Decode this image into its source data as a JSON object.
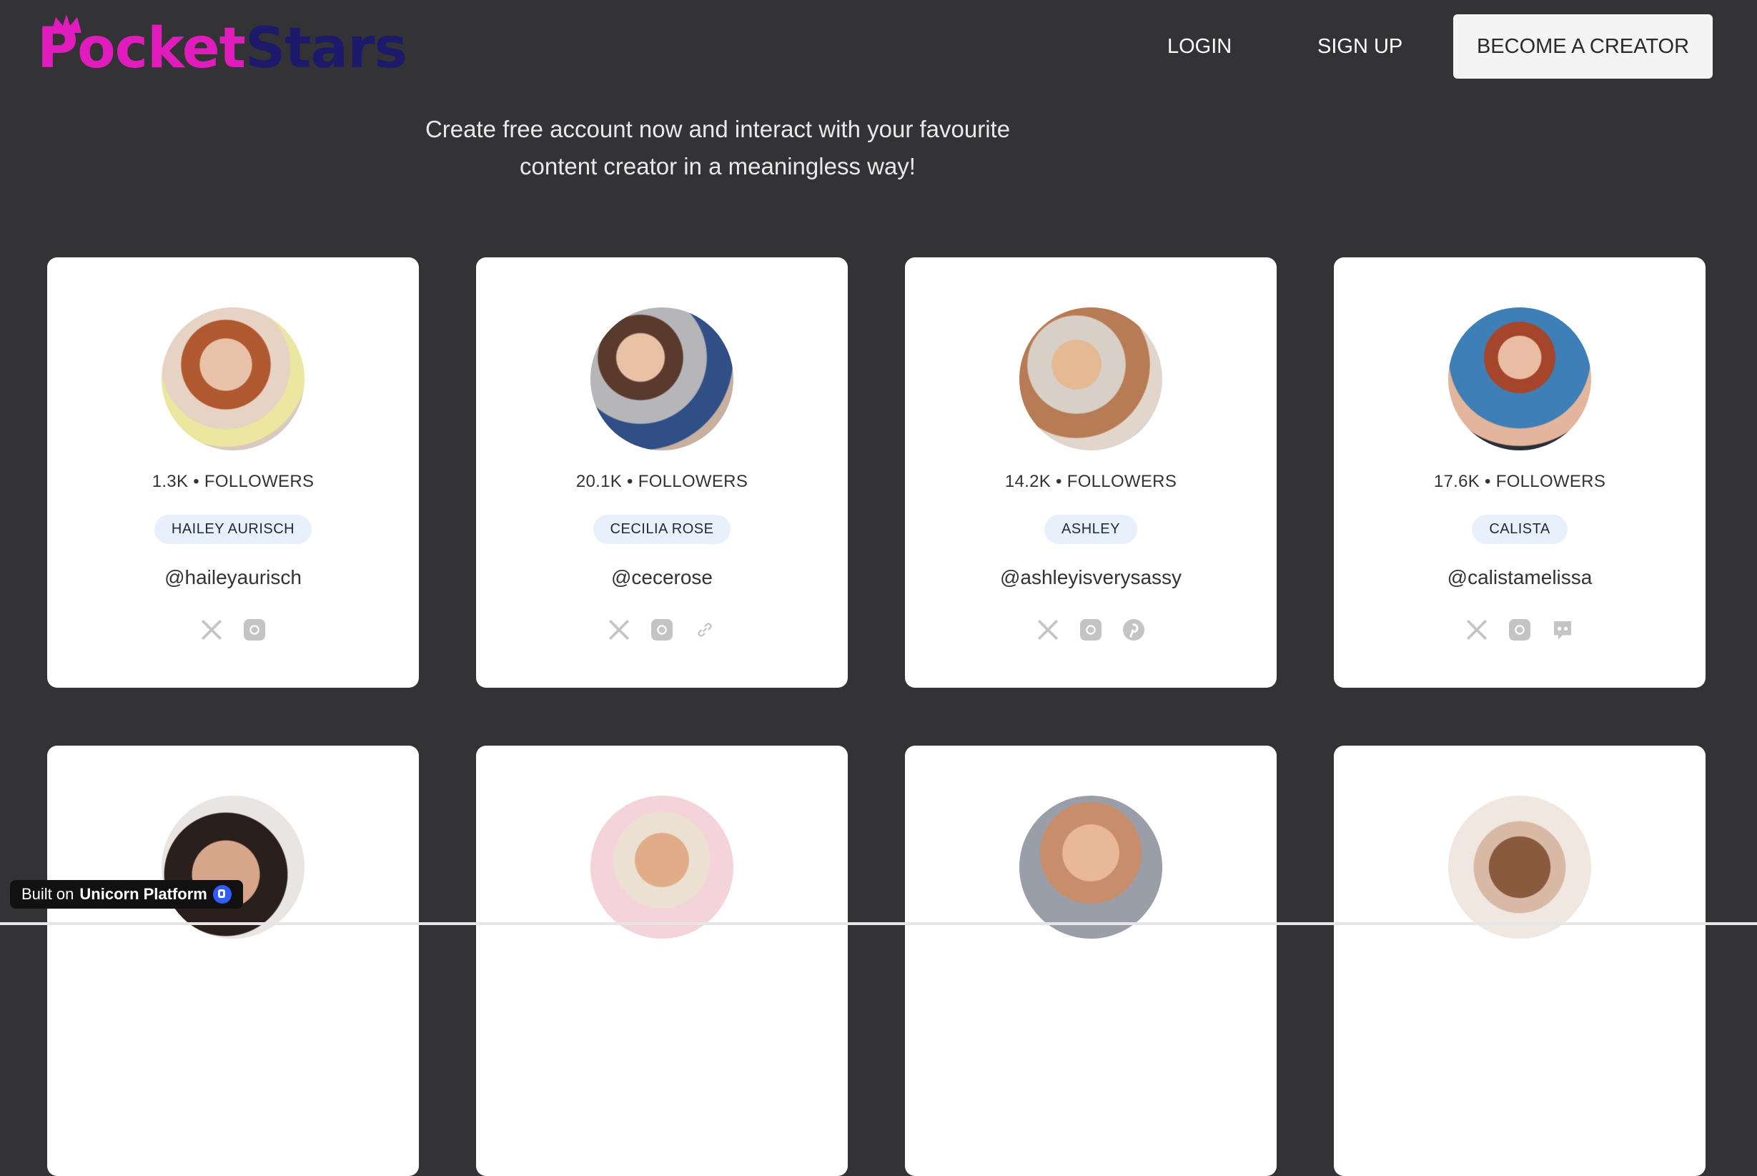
{
  "header": {
    "logo_part1": "Pocket",
    "logo_part2": "Stars",
    "login": "LOGIN",
    "signup": "SIGN UP",
    "cta": "BECOME A CREATOR"
  },
  "tagline": {
    "line1": "Create free account now and interact with your favourite",
    "line2": "content creator in a meaningless way!"
  },
  "creators": [
    {
      "followers": "1.3K • FOLLOWERS",
      "name": "HAILEY AURISCH",
      "handle": "@haileyaurisch",
      "socials": [
        "x-icon",
        "instagram-icon"
      ]
    },
    {
      "followers": "20.1K • FOLLOWERS",
      "name": "CECILIA ROSE",
      "handle": "@cecerose",
      "socials": [
        "x-icon",
        "instagram-icon",
        "link-icon"
      ]
    },
    {
      "followers": "14.2K • FOLLOWERS",
      "name": "ASHLEY",
      "handle": "@ashleyisverysassy",
      "socials": [
        "x-icon",
        "instagram-icon",
        "pinterest-icon"
      ]
    },
    {
      "followers": "17.6K • FOLLOWERS",
      "name": "CALISTA",
      "handle": "@calistamelissa",
      "socials": [
        "x-icon",
        "instagram-icon",
        "discord-icon"
      ]
    }
  ],
  "badge": {
    "prefix": "Built on",
    "brand": "Unicorn Platform"
  }
}
